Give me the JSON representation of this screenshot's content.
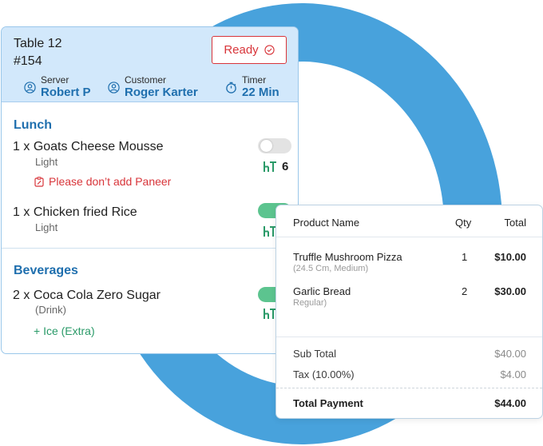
{
  "colors": {
    "accent_blue": "#1f6fae",
    "ring": "#48a2dc",
    "header_bg": "#d2e8fb",
    "ready_red": "#d8353a",
    "toggle_on": "#5cc48f",
    "extra_green": "#2a9a68"
  },
  "order": {
    "table": "Table 12",
    "number": "#154",
    "status_button": "Ready",
    "status_icon": "check-circle-icon",
    "meta": {
      "server_label": "Server",
      "server_value": "Robert P",
      "customer_label": "Customer",
      "customer_value": "Roger Karter",
      "timer_label": "Timer",
      "timer_value": "22 Min"
    },
    "sections": [
      {
        "title": "Lunch",
        "items": [
          {
            "qty": "1",
            "x": "x",
            "name": "Goats Cheese Mousse",
            "variant": "Light",
            "note": "Please don’t add Paneer",
            "toggle_on": false,
            "count": "6"
          },
          {
            "qty": "1",
            "x": "x",
            "name": "Chicken fried Rice",
            "variant": "Light",
            "toggle_on": true
          }
        ]
      },
      {
        "title": "Beverages",
        "items": [
          {
            "qty": "2",
            "x": "x",
            "name": "Coca Cola Zero Sugar",
            "variant": "(Drink)",
            "extra": "+ Ice (Extra)",
            "toggle_on": true
          }
        ]
      }
    ]
  },
  "bill": {
    "headers": {
      "product": "Product Name",
      "qty": "Qty",
      "total": "Total"
    },
    "rows": [
      {
        "name": "Truffle Mushroom Pizza",
        "sub": "(24.5 Cm, Medium)",
        "qty": "1",
        "total": "$10.00"
      },
      {
        "name": "Garlic Bread",
        "sub": "Regular)",
        "qty": "2",
        "total": "$30.00"
      }
    ],
    "sub_total_label": "Sub Total",
    "sub_total_value": "$40.00",
    "tax_label": "Tax (10.00%)",
    "tax_value": "$4.00",
    "total_label": "Total Payment",
    "total_value": "$44.00"
  }
}
